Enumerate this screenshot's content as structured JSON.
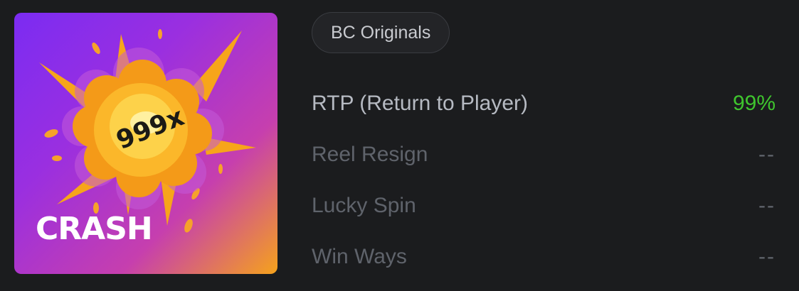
{
  "game": {
    "title": "CRASH",
    "multiplier": "999x"
  },
  "provider_chip": {
    "label": "BC Originals"
  },
  "stats": [
    {
      "label": "RTP (Return to Player)",
      "value": "99%"
    },
    {
      "label": "Reel Resign",
      "value": "--"
    },
    {
      "label": "Lucky Spin",
      "value": "--"
    },
    {
      "label": "Win Ways",
      "value": "--"
    }
  ],
  "colors": {
    "background": "#1b1c1e",
    "rtp_value": "#3fc52e",
    "label_active": "#b6bac2",
    "label_muted": "#5f636b"
  }
}
